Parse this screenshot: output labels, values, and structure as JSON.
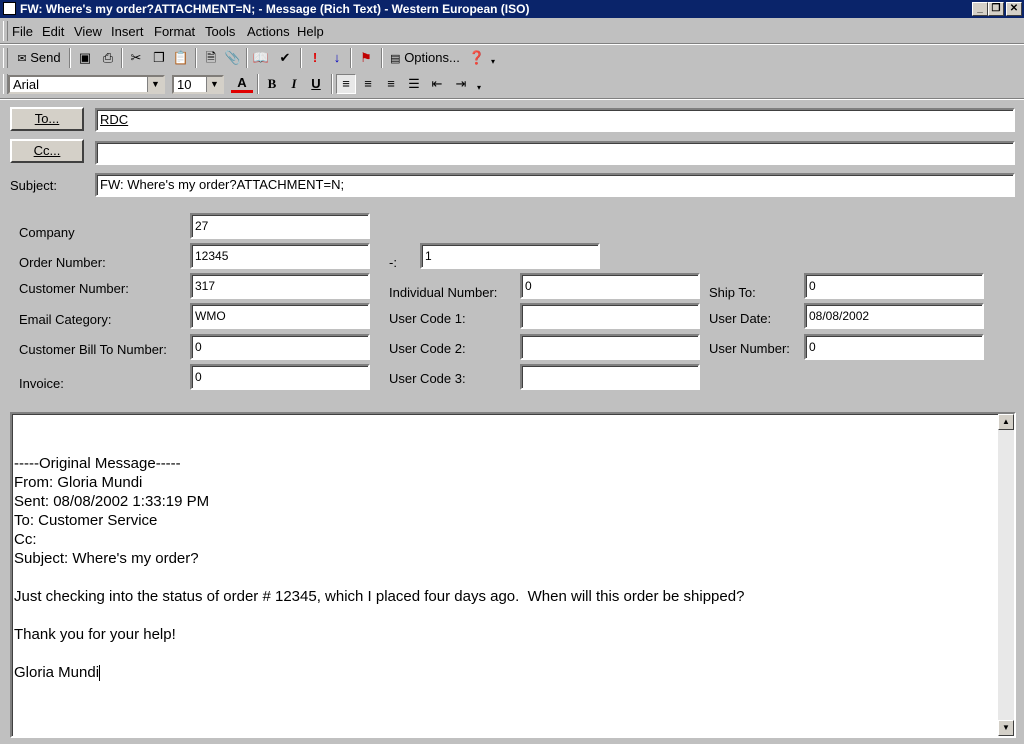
{
  "window": {
    "title": "FW: Where's my order?ATTACHMENT=N; - Message (Rich Text)  - Western European (ISO)",
    "controls": {
      "minimize": "_",
      "restore": "❐",
      "close": "✕"
    }
  },
  "menu": [
    "File",
    "Edit",
    "View",
    "Insert",
    "Format",
    "Tools",
    "Actions",
    "Help"
  ],
  "toolbar": {
    "send_label": "Send",
    "options_label": "Options...",
    "buttons": [
      "save-icon",
      "print-icon",
      "cut-icon",
      "copy-icon",
      "paste-icon",
      "insert-file-icon",
      "attach-icon",
      "address-book-icon",
      "check-names-icon",
      "importance-high-icon",
      "importance-low-icon",
      "flag-icon"
    ]
  },
  "format": {
    "font": "Arial",
    "size": "10",
    "font_color_label": "A",
    "bold": "B",
    "italic": "I",
    "underline": "U"
  },
  "address": {
    "to_label": "To...",
    "to_value": "RDC",
    "cc_label": "Cc...",
    "cc_value": "",
    "subject_label": "Subject:",
    "subject_value": "FW: Where's my order?ATTACHMENT=N;"
  },
  "form": {
    "company_label": "Company",
    "company": "27",
    "order_label": "Order Number:",
    "order": "12345",
    "dash_label": "-:",
    "order_suffix": "1",
    "customer_label": "Customer Number:",
    "customer": "317",
    "email_cat_label": "Email Category:",
    "email_cat": "WMO",
    "bill_to_label": "Customer Bill To Number:",
    "bill_to": "0",
    "invoice_label": "Invoice:",
    "invoice": "0",
    "individual_label": "Individual Number:",
    "individual": "0",
    "user_code1_label": "User Code 1:",
    "user_code1": "",
    "user_code2_label": "User Code 2:",
    "user_code2": "",
    "user_code3_label": "User Code 3:",
    "user_code3": "",
    "ship_to_label": "Ship To:",
    "ship_to": "0",
    "user_date_label": "User Date:",
    "user_date": "08/08/2002",
    "user_number_label": "User Number:",
    "user_number": "0"
  },
  "message": {
    "text": "-----Original Message-----\nFrom: Gloria Mundi\nSent: 08/08/2002 1:33:19 PM\nTo: Customer Service\nCc: \nSubject: Where's my order?\n\nJust checking into the status of order # 12345, which I placed four days ago.  When will this order be shipped?\n\nThank you for your help!\n\nGloria Mundi"
  }
}
